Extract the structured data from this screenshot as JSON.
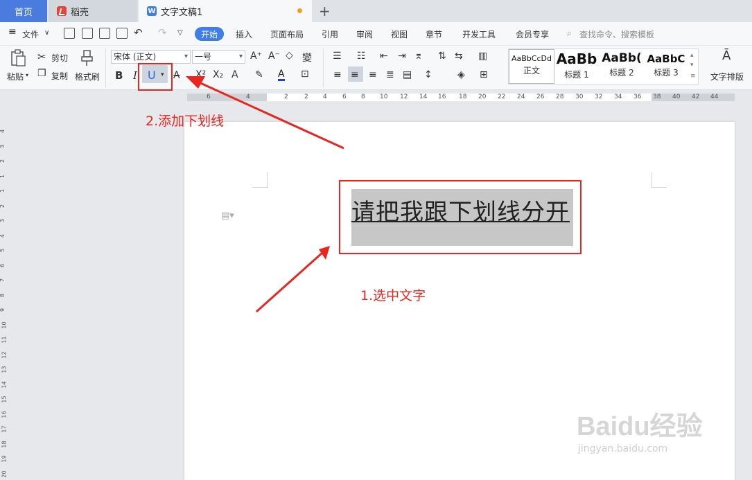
{
  "tabs": {
    "home": "首页",
    "daoke": "稻壳",
    "document": "文字文稿1"
  },
  "menu": {
    "file": "文件",
    "start": "开始",
    "insert": "插入",
    "layout": "页面布局",
    "references": "引用",
    "review": "审阅",
    "view": "视图",
    "chapter": "章节",
    "devtools": "开发工具",
    "member": "会员专享",
    "search_placeholder": "查找命令、搜索模板"
  },
  "ribbon": {
    "paste": "粘贴",
    "cut": "剪切",
    "copy": "复制",
    "format_painter": "格式刷",
    "font_name": "宋体 (正文)",
    "font_size": "一号",
    "bold": "B",
    "italic": "I",
    "underline": "U",
    "styles": [
      {
        "preview": "AaBbCcDd",
        "name": "正文"
      },
      {
        "preview": "AaBb",
        "name": "标题 1"
      },
      {
        "preview": "AaBb(",
        "name": "标题 2"
      },
      {
        "preview": "AaBbC",
        "name": "标题 3"
      }
    ],
    "text_layout": "文字排版"
  },
  "ruler": {
    "h_ticks": [
      "6",
      "4",
      "2",
      "2",
      "4",
      "6",
      "8",
      "10",
      "12",
      "14",
      "16",
      "18",
      "20",
      "22",
      "24",
      "26",
      "28",
      "30",
      "32",
      "34",
      "36",
      "38",
      "40",
      "42",
      "44",
      "46"
    ],
    "v_ticks": [
      "4",
      "3",
      "2",
      "1",
      "1",
      "2",
      "3",
      "4",
      "5",
      "6",
      "7",
      "8",
      "9",
      "10",
      "11",
      "12",
      "13",
      "14",
      "15",
      "16",
      "17",
      "18",
      "19",
      "20"
    ]
  },
  "document": {
    "selected_text": "请把我跟下划线分开"
  },
  "annotations": {
    "step1": "1.选中文字",
    "step2": "2.添加下划线"
  },
  "watermark": {
    "brand": "Baidu经验",
    "url": "jingyan.baidu.com"
  },
  "colors": {
    "accent": "#3f7de8",
    "annotation_red": "#e8261f",
    "selection": "#c7c7c7"
  }
}
